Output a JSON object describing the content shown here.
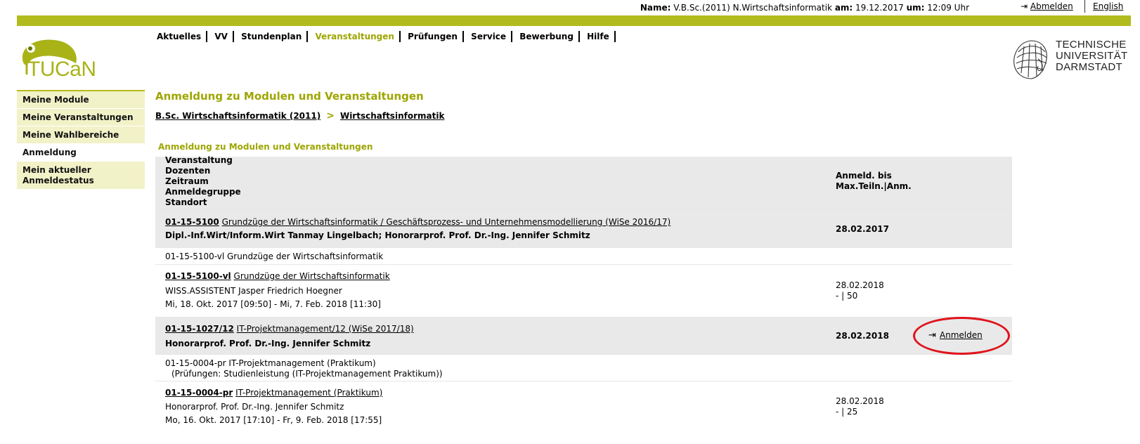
{
  "topbar": {
    "name_label": "Name:",
    "name_value": "V.B.Sc.(2011) N.Wirtschaftsinformatik",
    "date_label": "am:",
    "date_value": "19.12.2017",
    "time_label": "um:",
    "time_value": "12:09 Uhr",
    "logout": "Abmelden",
    "language": "English"
  },
  "logo": {
    "text": "TUCaN"
  },
  "university": {
    "line1": "TECHNISCHE",
    "line2": "UNIVERSITÄT",
    "line3": "DARMSTADT"
  },
  "nav": [
    "Aktuelles",
    "VV",
    "Stundenplan",
    "Veranstaltungen",
    "Prüfungen",
    "Service",
    "Bewerbung",
    "Hilfe"
  ],
  "sidebar": {
    "items": [
      {
        "label": "Meine Module"
      },
      {
        "label": "Meine Veranstaltungen"
      },
      {
        "label": "Meine Wahlbereiche"
      },
      {
        "label": "Anmeldung"
      },
      {
        "label": "Mein aktueller Anmeldestatus"
      }
    ]
  },
  "page_title": "Anmeldung zu Modulen und Veranstaltungen",
  "breadcrumb": {
    "item1": "B.Sc. Wirtschaftsinformatik (2011)",
    "separator": ">",
    "item2": "Wirtschaftsinformatik"
  },
  "section_title": "Anmeldung zu Modulen und Veranstaltungen",
  "table": {
    "header": {
      "col1": [
        "Veranstaltung",
        "Dozenten",
        "Zeitraum",
        "Anmeldegruppe",
        "Standort"
      ],
      "col2": [
        "Anmeld. bis",
        "Max.Teiln.|Anm."
      ]
    },
    "rows": [
      {
        "code": "01-15-5100",
        "title": "Grundzüge der Wirtschaftsinformatik / Geschäftsprozess- und Unternehmensmodellierung (WiSe 2016/17)",
        "lecturer": "Dipl.-Inf.Wirt/Inform.Wirt Tanmay Lingelbach; Honorarprof. Prof. Dr.-Ing. Jennifer Schmitz",
        "deadline": "28.02.2017"
      },
      {
        "text": "01-15-5100-vl Grundzüge der Wirtschaftsinformatik"
      },
      {
        "code": "01-15-5100-vl",
        "title": "Grundzüge der Wirtschaftsinformatik",
        "lecturer": "WISS.ASSISTENT Jasper Friedrich Hoegner",
        "period": "Mi, 18. Okt. 2017 [09:50] - Mi, 7. Feb. 2018 [11:30]",
        "deadline": "28.02.2018",
        "capacity": "- | 50"
      },
      {
        "code": "01-15-1027/12",
        "title": "IT-Projektmanagement/12 (WiSe 2017/18)",
        "lecturer": "Honorarprof. Prof. Dr.-Ing. Jennifer Schmitz",
        "deadline": "28.02.2018",
        "action": "Anmelden"
      },
      {
        "text": "01-15-0004-pr IT-Projektmanagement (Praktikum)",
        "subtext": "(Prüfungen: Studienleistung (IT-Projektmanagement Praktikum))"
      },
      {
        "code": "01-15-0004-pr",
        "title": "IT-Projektmanagement (Praktikum)",
        "lecturer": "Honorarprof. Prof. Dr.-Ing. Jennifer Schmitz",
        "period": "Mo, 16. Okt. 2017 [17:10] - Fr, 9. Feb. 2018 [17:55]",
        "deadline": "28.02.2018",
        "capacity": "- | 25"
      }
    ]
  },
  "colors": {
    "accent": "#b2bb1e",
    "title": "#9ea600",
    "highlight_oval": "#e0131b"
  }
}
